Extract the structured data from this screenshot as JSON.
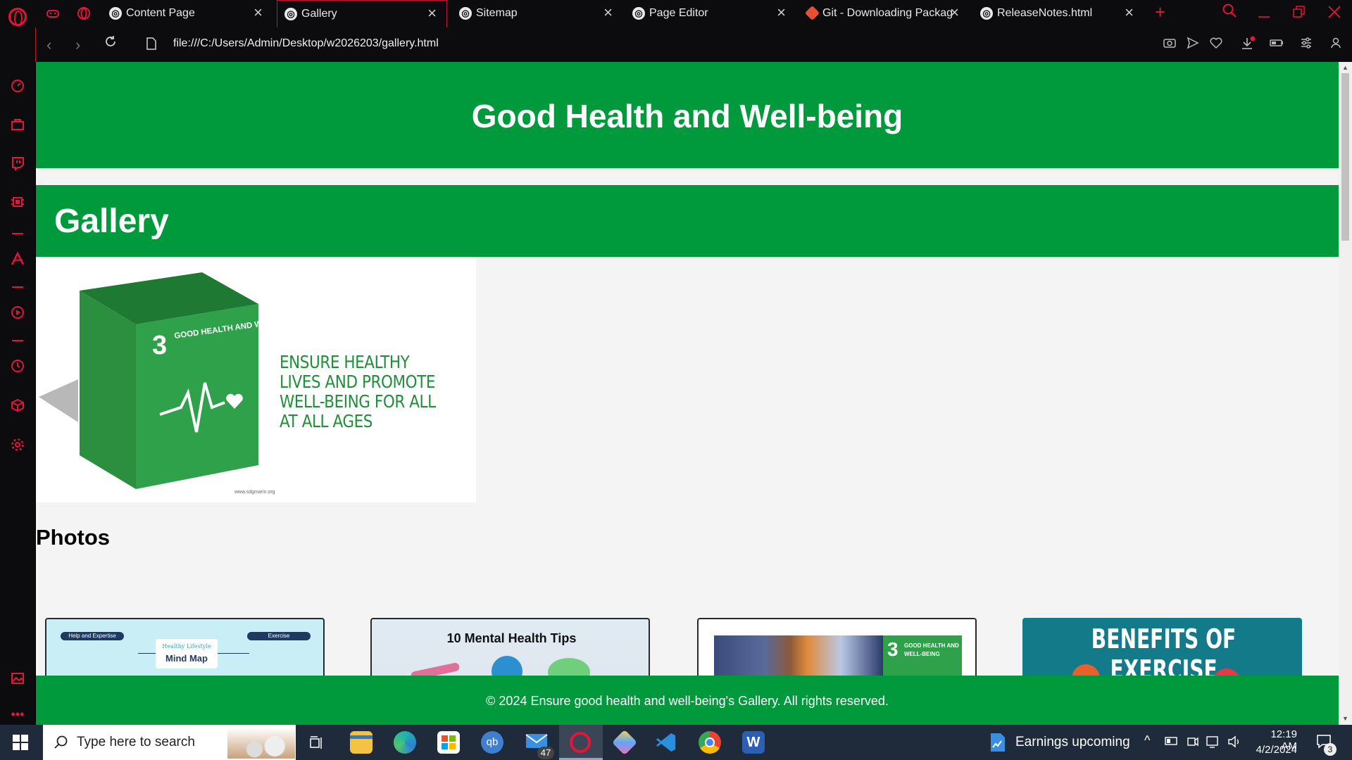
{
  "tabs": [
    {
      "title": "Content Page",
      "active": false
    },
    {
      "title": "Gallery",
      "active": true
    },
    {
      "title": "Sitemap",
      "active": false
    },
    {
      "title": "Page Editor",
      "active": false
    },
    {
      "title": "Git - Downloading Package",
      "active": false
    },
    {
      "title": "ReleaseNotes.html",
      "active": false
    }
  ],
  "address": {
    "url": "file:///C:/Users/Admin/Desktop/w2026203/gallery.html"
  },
  "page": {
    "header_title": "Good Health and Well-being",
    "gallery_title": "Gallery",
    "banner": {
      "goal_number": "3",
      "goal_name": "GOOD HEALTH AND WELL-BEING",
      "text": "ENSURE HEALTHY LIVES AND PROMOTE WELL-BEING FOR ALL AT ALL AGES",
      "site": "www.sdgmarin.org"
    },
    "photos_title": "Photos",
    "photos": [
      {
        "heading": "Mind Map",
        "subheading": "Healthy Lifestyle",
        "left_tag": "Help and Expertise",
        "right_tag": "Exercise"
      },
      {
        "heading": "10 Mental Health Tips"
      },
      {
        "heading": "GOOD HEALTH AND WELL-BEING",
        "number": "3"
      },
      {
        "heading": "BENEFITS OF EXERCISE"
      }
    ],
    "footer": "© 2024 Ensure good health and well-being's Gallery. All rights reserved."
  },
  "taskbar": {
    "search_placeholder": "Type here to search",
    "mail_badge": "47",
    "tray_text": "Earnings upcoming",
    "time": "12:19 AM",
    "date": "4/2/2024",
    "notification_count": "3"
  },
  "colors": {
    "accent": "#e5143a",
    "green": "#009a3d"
  }
}
